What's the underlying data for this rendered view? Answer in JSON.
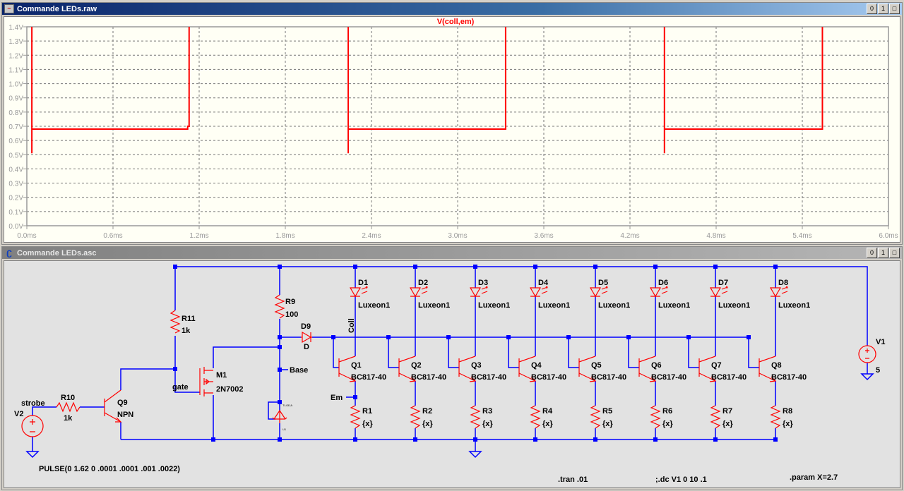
{
  "waveform_window": {
    "title": "Commande LEDs.raw",
    "buttons": [
      "0",
      "1",
      "□"
    ]
  },
  "schematic_window": {
    "title": "Commande LEDs.asc",
    "buttons": [
      "0",
      "1",
      "□"
    ]
  },
  "chart_data": {
    "type": "line",
    "title": "",
    "xlabel": "",
    "ylabel": "",
    "xlim": [
      0,
      6.0
    ],
    "ylim": [
      0,
      1.4
    ],
    "grid": true,
    "x_ticks": [
      "0.0ms",
      "0.6ms",
      "1.2ms",
      "1.8ms",
      "2.4ms",
      "3.0ms",
      "3.6ms",
      "4.2ms",
      "4.8ms",
      "5.4ms",
      "6.0ms"
    ],
    "y_ticks": [
      "0.0V",
      "0.1V",
      "0.2V",
      "0.3V",
      "0.4V",
      "0.5V",
      "0.6V",
      "0.7V",
      "0.8V",
      "0.9V",
      "1.0V",
      "1.1V",
      "1.2V",
      "1.3V",
      "1.4V"
    ],
    "background": "#fffff5",
    "series": [
      {
        "name": "V(coll,em)",
        "color": "#ff0000",
        "points": [
          [
            0.035,
            0.51
          ],
          [
            0.035,
            1.5
          ],
          [
            0.035,
            0.68
          ],
          [
            1.12,
            0.68
          ],
          [
            1.12,
            0.7
          ],
          [
            1.13,
            0.7
          ],
          [
            1.13,
            1.5
          ],
          [
            2.238,
            1.5
          ],
          [
            2.238,
            0.51
          ],
          [
            2.238,
            0.68
          ],
          [
            3.334,
            0.68
          ],
          [
            3.334,
            1.5
          ],
          [
            4.44,
            1.5
          ],
          [
            4.44,
            0.51
          ],
          [
            4.44,
            0.68
          ],
          [
            5.54,
            0.68
          ],
          [
            5.54,
            1.5
          ],
          [
            6.0,
            1.5
          ]
        ]
      }
    ]
  },
  "schematic": {
    "wire_color": "#0000ff",
    "component_color": "#ff0000",
    "labels": {
      "R11": "R11",
      "R11_value": "1k",
      "R10": "R10",
      "R10_value": "1k",
      "R9": "R9",
      "R9_value": "100",
      "D9": "D9",
      "D9_value": "D",
      "Q9": "Q9",
      "Q9_value": "NPN",
      "M1": "M1",
      "M1_value": "2N7002",
      "V2": "V2",
      "strobe": "strobe",
      "V1": "V1",
      "V1_value": "5",
      "gate": "gate",
      "base": "Base",
      "em": "Em",
      "coll": "Coll",
      "U1_part": "TL431A",
      "U1": "U1"
    },
    "channels": [
      {
        "led": "D1",
        "led_value": "Luxeon1",
        "q": "Q1",
        "q_value": "BC817-40",
        "r": "R1",
        "r_value": "{x}"
      },
      {
        "led": "D2",
        "led_value": "Luxeon1",
        "q": "Q2",
        "q_value": "BC817-40",
        "r": "R2",
        "r_value": "{x}"
      },
      {
        "led": "D3",
        "led_value": "Luxeon1",
        "q": "Q3",
        "q_value": "BC817-40",
        "r": "R3",
        "r_value": "{x}"
      },
      {
        "led": "D4",
        "led_value": "Luxeon1",
        "q": "Q4",
        "q_value": "BC817-40",
        "r": "R4",
        "r_value": "{x}"
      },
      {
        "led": "D5",
        "led_value": "Luxeon1",
        "q": "Q5",
        "q_value": "BC817-40",
        "r": "R5",
        "r_value": "{x}"
      },
      {
        "led": "D6",
        "led_value": "Luxeon1",
        "q": "Q6",
        "q_value": "BC817-40",
        "r": "R6",
        "r_value": "{x}"
      },
      {
        "led": "D7",
        "led_value": "Luxeon1",
        "q": "Q7",
        "q_value": "BC817-40",
        "r": "R7",
        "r_value": "{x}"
      },
      {
        "led": "D8",
        "led_value": "Luxeon1",
        "q": "Q8",
        "q_value": "BC817-40",
        "r": "R8",
        "r_value": "{x}"
      }
    ],
    "directives": {
      "pulse": "PULSE(0 1.62 0 .0001 .0001 .001 .0022)",
      "tran": ".tran .01",
      "dc": ";.dc V1 0 10 .1",
      "param": ".param X=2.7"
    }
  }
}
